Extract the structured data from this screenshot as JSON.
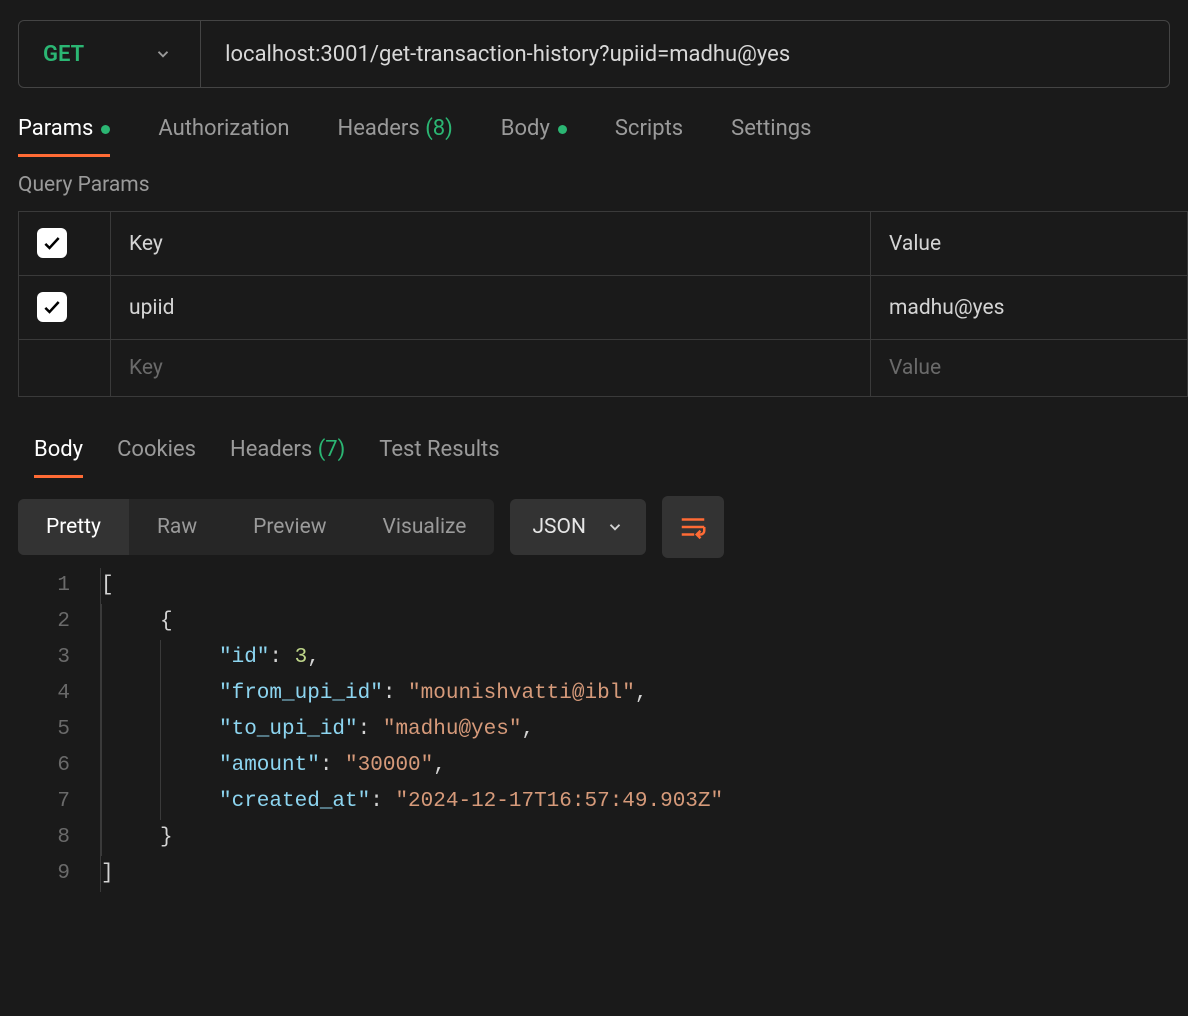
{
  "request": {
    "method": "GET",
    "url": "localhost:3001/get-transaction-history?upiid=madhu@yes"
  },
  "request_tabs": {
    "params": "Params",
    "authorization": "Authorization",
    "headers": "Headers",
    "headers_count": "(8)",
    "body": "Body",
    "scripts": "Scripts",
    "settings": "Settings"
  },
  "params_section": {
    "title": "Query Params",
    "columns": {
      "key": "Key",
      "value": "Value"
    },
    "rows": [
      {
        "key": "upiid",
        "value": "madhu@yes"
      }
    ],
    "placeholder": {
      "key": "Key",
      "value": "Value"
    }
  },
  "response_tabs": {
    "body": "Body",
    "cookies": "Cookies",
    "headers": "Headers",
    "headers_count": "(7)",
    "test_results": "Test Results"
  },
  "view": {
    "pretty": "Pretty",
    "raw": "Raw",
    "preview": "Preview",
    "visualize": "Visualize",
    "format": "JSON"
  },
  "response_body": {
    "line1": "[",
    "line2": "{",
    "line3_key": "\"id\"",
    "line3_val": "3",
    "line4_key": "\"from_upi_id\"",
    "line4_val": "\"mounishvatti@ibl\"",
    "line5_key": "\"to_upi_id\"",
    "line5_val": "\"madhu@yes\"",
    "line6_key": "\"amount\"",
    "line6_val": "\"30000\"",
    "line7_key": "\"created_at\"",
    "line7_val": "\"2024-12-17T16:57:49.903Z\"",
    "line8": "}",
    "line9": "]"
  },
  "line_numbers": {
    "l1": "1",
    "l2": "2",
    "l3": "3",
    "l4": "4",
    "l5": "5",
    "l6": "6",
    "l7": "7",
    "l8": "8",
    "l9": "9"
  }
}
